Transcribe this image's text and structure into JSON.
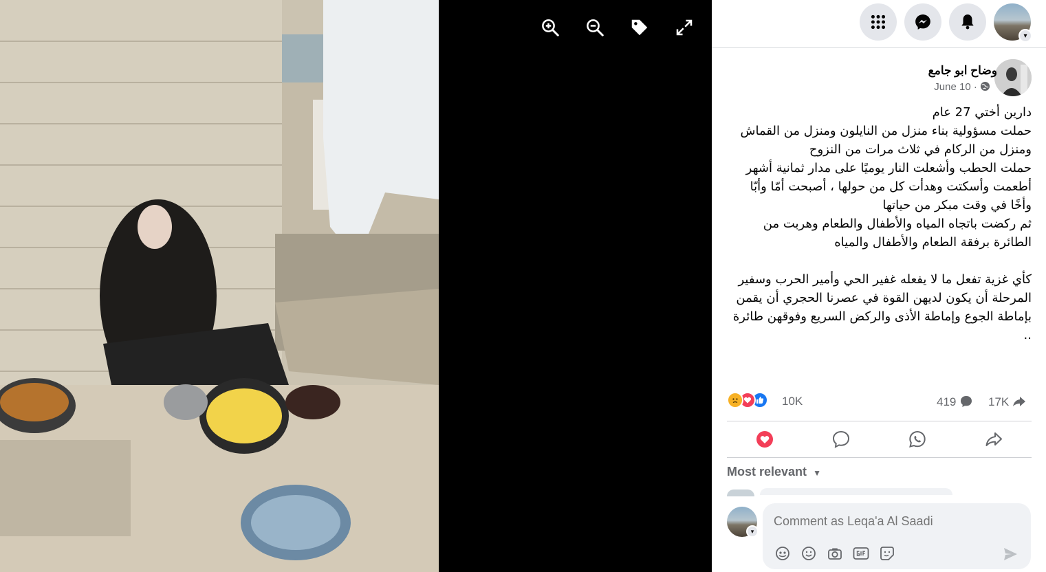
{
  "viewer": {
    "tools": [
      {
        "name": "zoom-in-icon"
      },
      {
        "name": "zoom-out-icon"
      },
      {
        "name": "tag-icon"
      },
      {
        "name": "fullscreen-icon"
      }
    ]
  },
  "topbar": {
    "icons": [
      "menu-grid-icon",
      "messenger-icon",
      "bell-icon"
    ]
  },
  "post": {
    "author": "وضاح ابو جامع",
    "date": "June 10 · ",
    "privacy_icon": "globe-icon",
    "body": "دارين أختي 27 عام\nحملت مسؤولية بناء منزل من النايلون ومنزل من القماش ومنزل من الركام في ثلاث مرات من النزوح\nحملت الحطب وأشعلت النار يوميًا على مدار ثمانية أشهر\nأطعمت وأسكتت وهدأت كل من حولها ، أصبحت أمّا وأبّا وأخًا في وقت مبكر من حياتها\nثم ركضت باتجاه المياه والأطفال والطعام وهربت من الطائرة برفقة الطعام والأطفال والمياه\n\nكأي غزية تفعل ما لا يفعله غفير الحي وأمير الحرب وسفير المرحلة أن يكون لديهن القوة في عصرنا الحجري أن يقمن بإماطة الجوع وإماطة الأذى والركض السريع وفوقهن طائرة .."
  },
  "stats": {
    "reactions": "10K",
    "comments": "419",
    "shares": "17K",
    "reaction_colors": {
      "sad": "#f7b125",
      "love": "#f33e58",
      "like": "#1877f2"
    }
  },
  "comments": {
    "sort_label": "Most relevant",
    "placeholder": "Comment as Leqa'a Al Saadi"
  },
  "colors": {
    "accent": "#1877f2",
    "love": "#f33e58"
  }
}
